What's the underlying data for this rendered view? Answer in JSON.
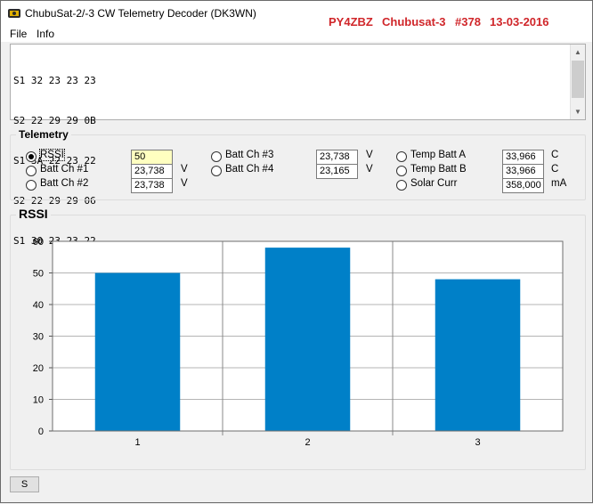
{
  "window": {
    "title": "ChubuSat-2/-3 CW Telemetry Decoder (DK3WN)",
    "callsign": "PY4ZBZ",
    "satellite": "Chubusat-3",
    "frame": "#378",
    "date": "13-03-2016"
  },
  "menu": {
    "file": "File",
    "info": "Info"
  },
  "log": {
    "lines": [
      "S1 32 23 23 23",
      "S2 22 29 29 0B",
      "S1 3A 22 23 22",
      "S2 22 29 29 06",
      "S1 30 23 23 22"
    ]
  },
  "telemetry": {
    "title": "Telemetry",
    "items": [
      {
        "label": "RSSI",
        "value": "50",
        "unit": "",
        "selected": true
      },
      {
        "label": "Batt Ch #1",
        "value": "23,738",
        "unit": "V",
        "selected": false
      },
      {
        "label": "Batt Ch #2",
        "value": "23,738",
        "unit": "V",
        "selected": false
      },
      {
        "label": "Batt Ch #3",
        "value": "23,738",
        "unit": "V",
        "selected": false
      },
      {
        "label": "Batt Ch #4",
        "value": "23,165",
        "unit": "V",
        "selected": false
      },
      {
        "label": "Temp Batt A",
        "value": "33,966",
        "unit": "C",
        "selected": false
      },
      {
        "label": "Temp Batt B",
        "value": "33,966",
        "unit": "C",
        "selected": false
      },
      {
        "label": "Solar Curr",
        "value": "358,000",
        "unit": "mA",
        "selected": false
      }
    ]
  },
  "chart_group": {
    "title": "RSSI"
  },
  "chart_data": {
    "type": "bar",
    "categories": [
      "1",
      "2",
      "3"
    ],
    "values": [
      50,
      58,
      48
    ],
    "title": "",
    "xlabel": "",
    "ylabel": "",
    "ylim": [
      0,
      60
    ],
    "yticks": [
      0,
      10,
      20,
      30,
      40,
      50,
      60
    ],
    "grid": true,
    "bar_color": "#0080c8"
  },
  "buttons": {
    "s_label": "S"
  }
}
